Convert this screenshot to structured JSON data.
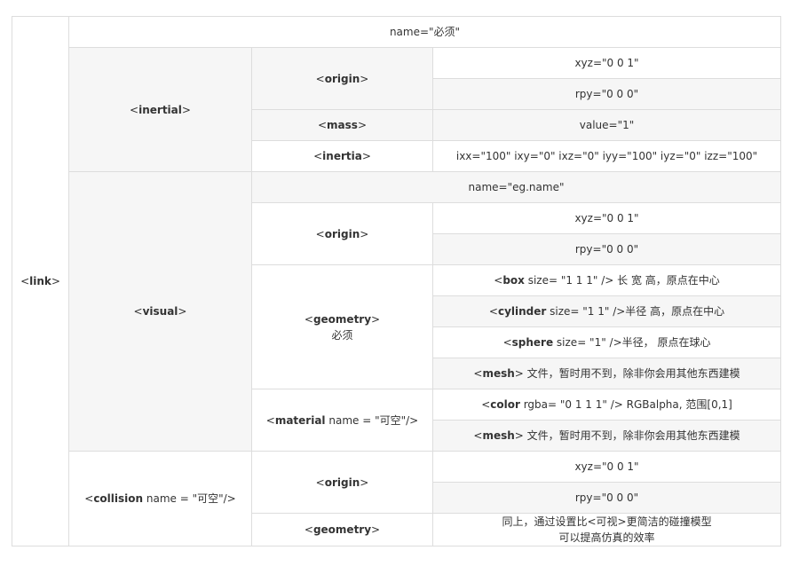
{
  "link_tag": "link",
  "name_required": "name=\"必须\"",
  "inertial": {
    "tag": "inertial",
    "origin_tag": "origin",
    "xyz": "xyz=\"0 0 1\"",
    "rpy": "rpy=\"0 0 0\"",
    "mass_tag": "mass",
    "mass_value": "value=\"1\"",
    "inertia_tag": "inertia",
    "inertia_value": "ixx=\"100\" ixy=\"0\" ixz=\"0\" iyy=\"100\" iyz=\"0\" izz=\"100\""
  },
  "visual": {
    "tag": "visual",
    "name": "name=\"eg.name\"",
    "origin_tag": "origin",
    "xyz": "xyz=\"0 0 1\"",
    "rpy": "rpy=\"0 0 0\"",
    "geometry_tag": "geometry",
    "geometry_note": "必须",
    "box_tag": "box",
    "box_rest": " size= \"1 1 1\" /> 长 宽 高，原点在中心",
    "cylinder_tag": "cylinder",
    "cylinder_rest": " size= \"1 1\" />半径 高，原点在中心",
    "sphere_tag": "sphere",
    "sphere_rest": " size= \"1\" />半径， 原点在球心",
    "mesh_tag": "mesh",
    "mesh_rest": " 文件，暂时用不到，除非你会用其他东西建模",
    "material_tag": "material",
    "material_rest": " name = \"可空\"/>",
    "color_tag": "color",
    "color_rest": " rgba= \"0 1 1 1\" /> RGBalpha, 范围[0,1]",
    "material_mesh_tag": "mesh",
    "material_mesh_rest": " 文件，暂时用不到，除非你会用其他东西建模"
  },
  "collision": {
    "tag": "collision",
    "tag_rest": " name = \"可空\"/>",
    "origin_tag": "origin",
    "xyz": "xyz=\"0 0 1\"",
    "rpy": "rpy=\"0 0 0\"",
    "geometry_tag": "geometry",
    "geometry_note_line1": "同上，通过设置比<可视>更简洁的碰撞模型",
    "geometry_note_line2": "可以提高仿真的效率"
  }
}
